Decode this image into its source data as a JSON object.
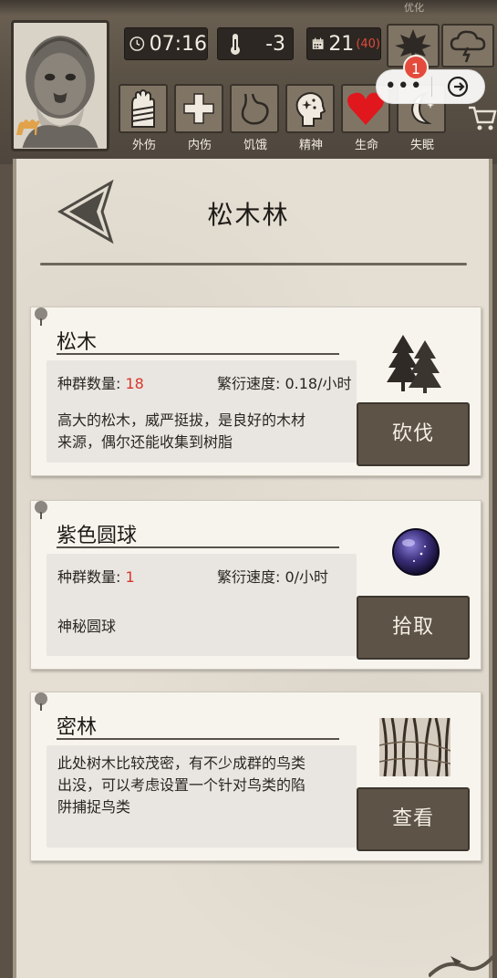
{
  "hud": {
    "top_tiny": "优化",
    "time": "07:16",
    "temperature": "-3",
    "day": "21",
    "day_max": "(40)",
    "notification_count": "1",
    "capsule_more": "•••"
  },
  "status": [
    {
      "label": "外伤",
      "icon": "bandaged-hand-icon"
    },
    {
      "label": "内伤",
      "icon": "cross-icon"
    },
    {
      "label": "饥饿",
      "icon": "stomach-icon"
    },
    {
      "label": "精神",
      "icon": "head-sparkle-icon"
    },
    {
      "label": "生命",
      "icon": "heart-icon"
    },
    {
      "label": "失眠",
      "icon": "moon-icon"
    }
  ],
  "page": {
    "title": "松木林"
  },
  "cards": [
    {
      "name": "松木",
      "population_label": "种群数量: ",
      "population": "18",
      "growth": "繁衍速度: 0.18/小时",
      "desc_lines": [
        "高大的松木，威严挺拔，是良好的木材",
        "来源，偶尔还能收集到树脂"
      ],
      "action": "砍伐",
      "thumb": "pine-trees-icon"
    },
    {
      "name": "紫色圆球",
      "population_label": "种群数量: ",
      "population": "1",
      "growth": "繁衍速度: 0/小时",
      "desc_lines": [
        "神秘圆球"
      ],
      "action": "拾取",
      "thumb": "purple-orb-icon"
    },
    {
      "name": "密林",
      "desc_lines": [
        "此处树木比较茂密，有不少成群的鸟类",
        "出没，可以考虑设置一个针对鸟类的陷",
        "阱捕捉鸟类"
      ],
      "action": "查看",
      "thumb": "dense-forest-icon"
    }
  ],
  "colors": {
    "accent_red": "#d9362a",
    "button_bg": "#5d5346",
    "panel_bg": "#e4ded3",
    "orb_purple": "#3b2f7a"
  }
}
